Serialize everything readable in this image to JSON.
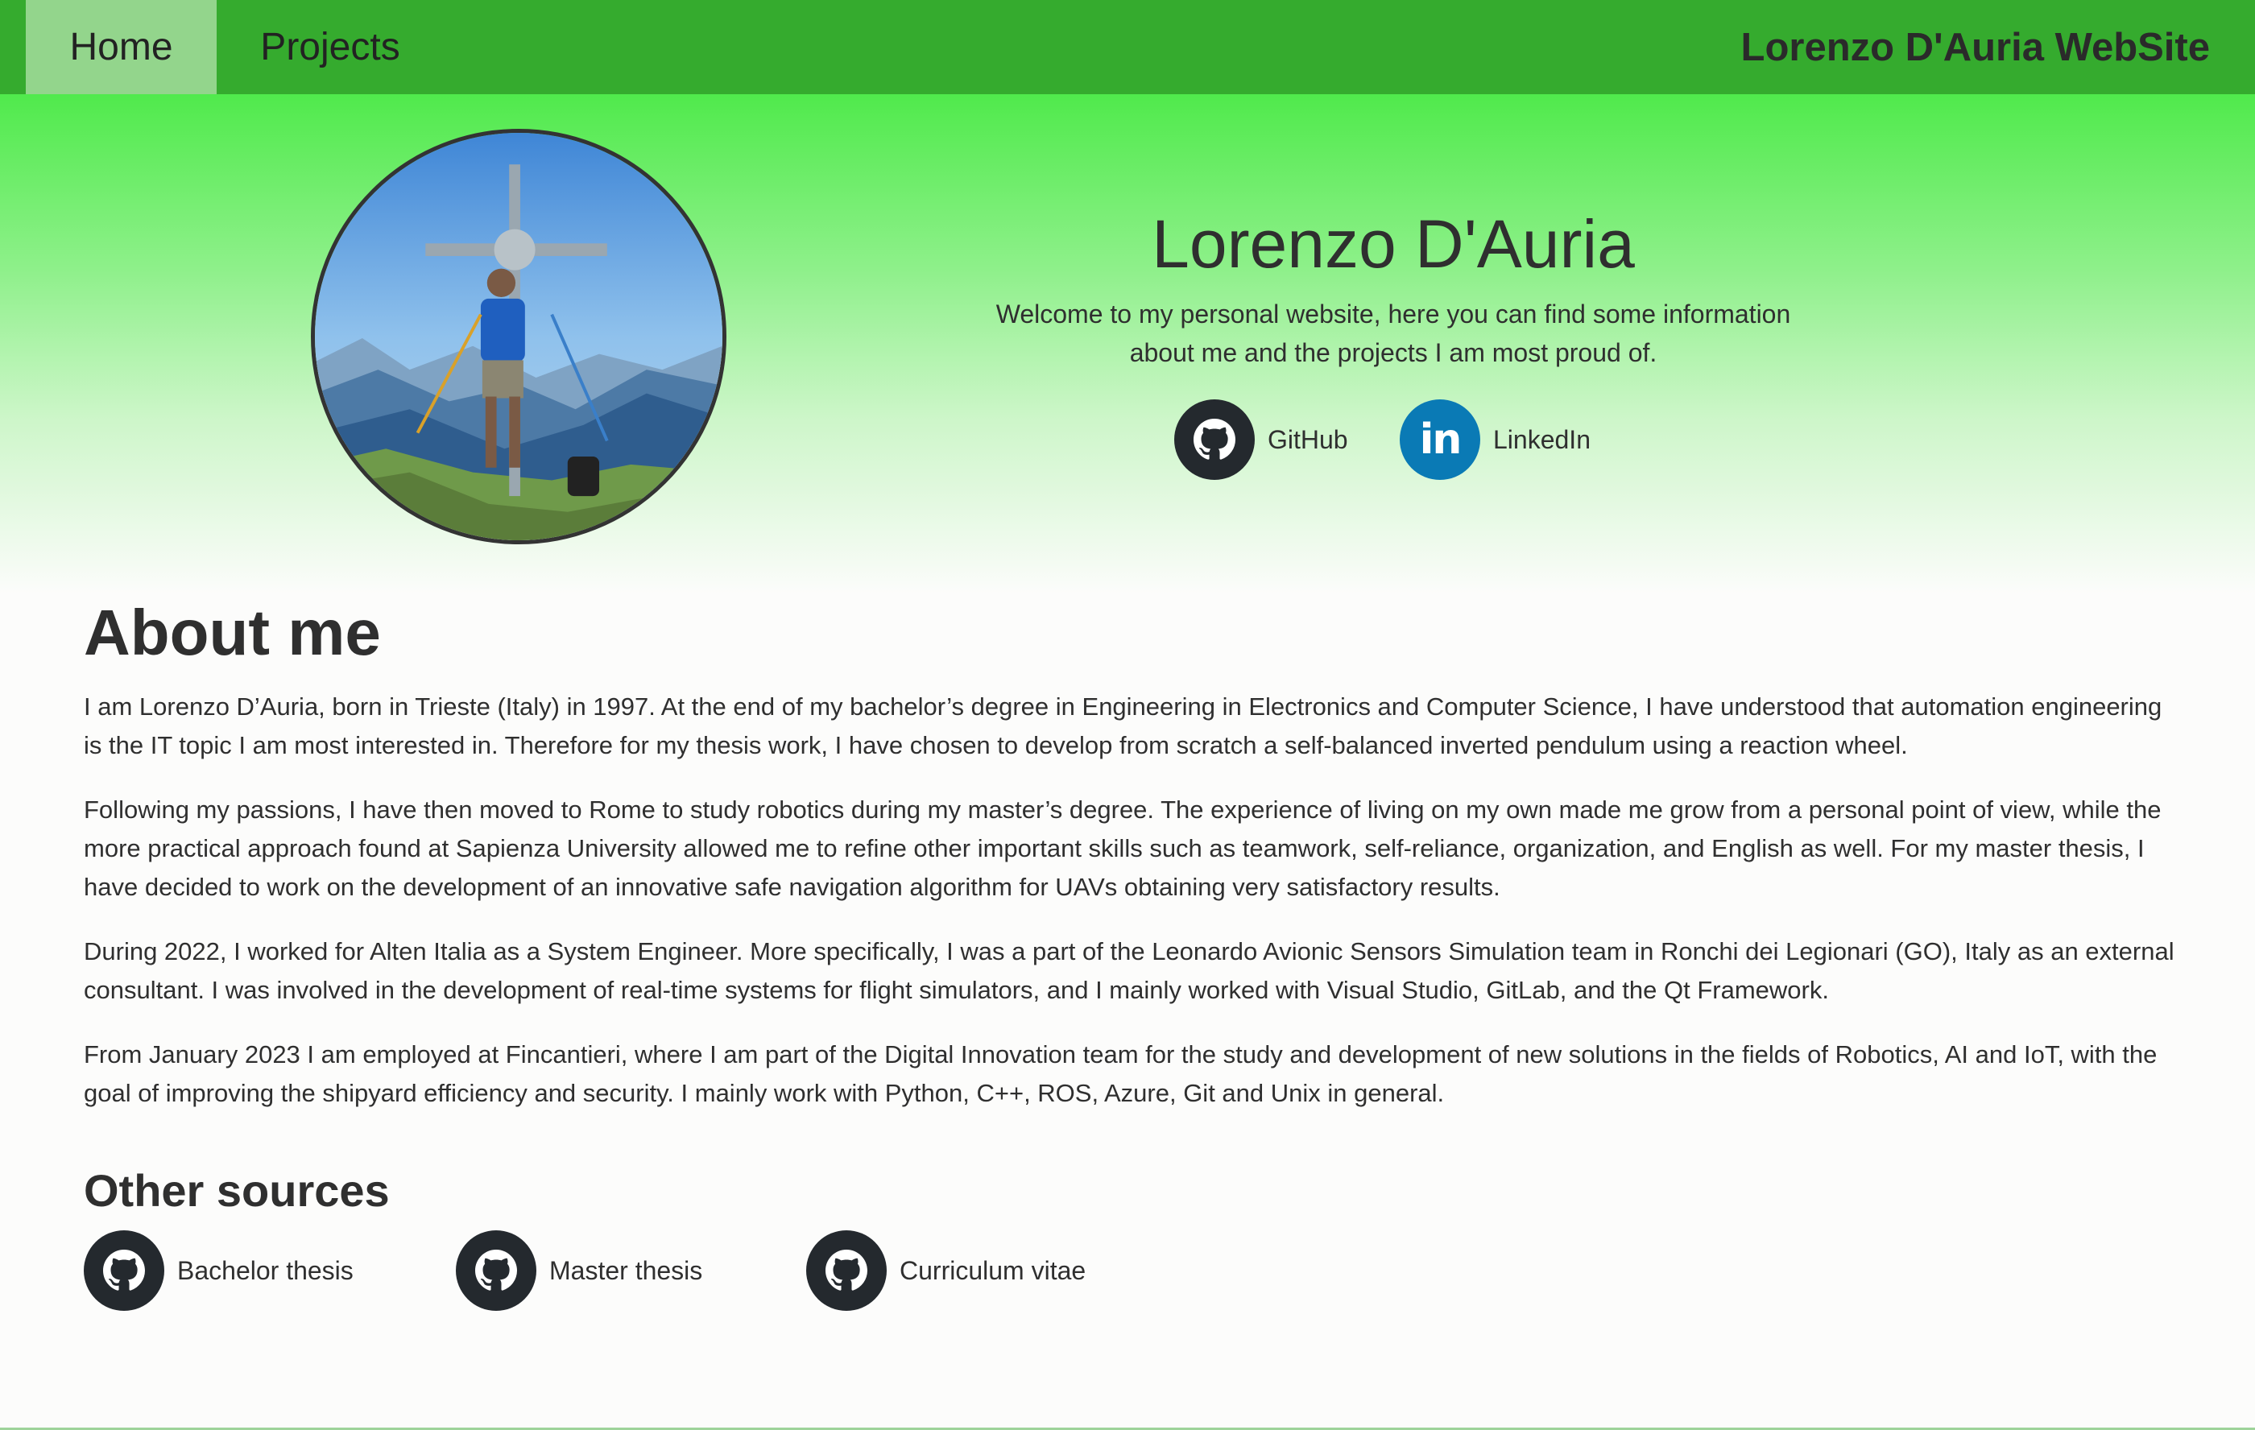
{
  "nav": {
    "items": [
      {
        "label": "Home",
        "active": true
      },
      {
        "label": "Projects",
        "active": false
      }
    ],
    "brand": "Lorenzo D'Auria WebSite"
  },
  "hero": {
    "name": "Lorenzo D'Auria",
    "welcome_line1": "Welcome to my personal website, here you can find some information",
    "welcome_line2": "about me and the projects I am most proud of.",
    "links": [
      {
        "label": "GitHub",
        "icon": "github-icon"
      },
      {
        "label": "LinkedIn",
        "icon": "linkedin-icon"
      }
    ],
    "linkedin_mark": "in"
  },
  "about": {
    "title": "About me",
    "paragraphs": [
      "I am Lorenzo D’Auria, born in Trieste (Italy) in 1997. At the end of my bachelor’s degree in Engineering in Electronics and Computer Science, I have understood that automation engineering is the IT topic I am most interested in. Therefore for my thesis work, I have chosen to develop from scratch a self-balanced inverted pendulum using a reaction wheel.",
      "Following my passions, I have then moved to Rome to study robotics during my master’s degree. The experience of living on my own made me grow from a personal point of view, while the more practical approach found at Sapienza University allowed me to refine other important skills such as teamwork, self-reliance, organization, and English as well. For my master thesis, I have decided to work on the development of an innovative safe navigation algorithm for UAVs obtaining very satisfactory results.",
      "During 2022, I worked for Alten Italia as a System Engineer. More specifically, I was a part of the Leonardo Avionic Sensors Simulation team in Ronchi dei Legionari (GO), Italy as an external consultant. I was involved in the development of real-time systems for flight simulators, and I mainly worked with Visual Studio, GitLab, and the Qt Framework.",
      "From January 2023 I am employed at Fincantieri, where I am part of the Digital Innovation team for the study and development of new solutions in the fields of Robotics, AI and IoT, with the goal of improving the shipyard efficiency and security. I mainly work with Python, C++, ROS, Azure, Git and Unix in general."
    ]
  },
  "other_sources": {
    "title": "Other sources",
    "items": [
      {
        "label": "Bachelor thesis",
        "icon": "github-icon"
      },
      {
        "label": "Master thesis",
        "icon": "github-icon"
      },
      {
        "label": "Curriculum vitae",
        "icon": "github-icon"
      }
    ]
  },
  "colors": {
    "navbar": "#35ab2e",
    "nav_active": "#93d58c",
    "hero_top": "#50ea4c",
    "github_circle": "#24292e",
    "linkedin_circle": "#0a7ab5"
  }
}
